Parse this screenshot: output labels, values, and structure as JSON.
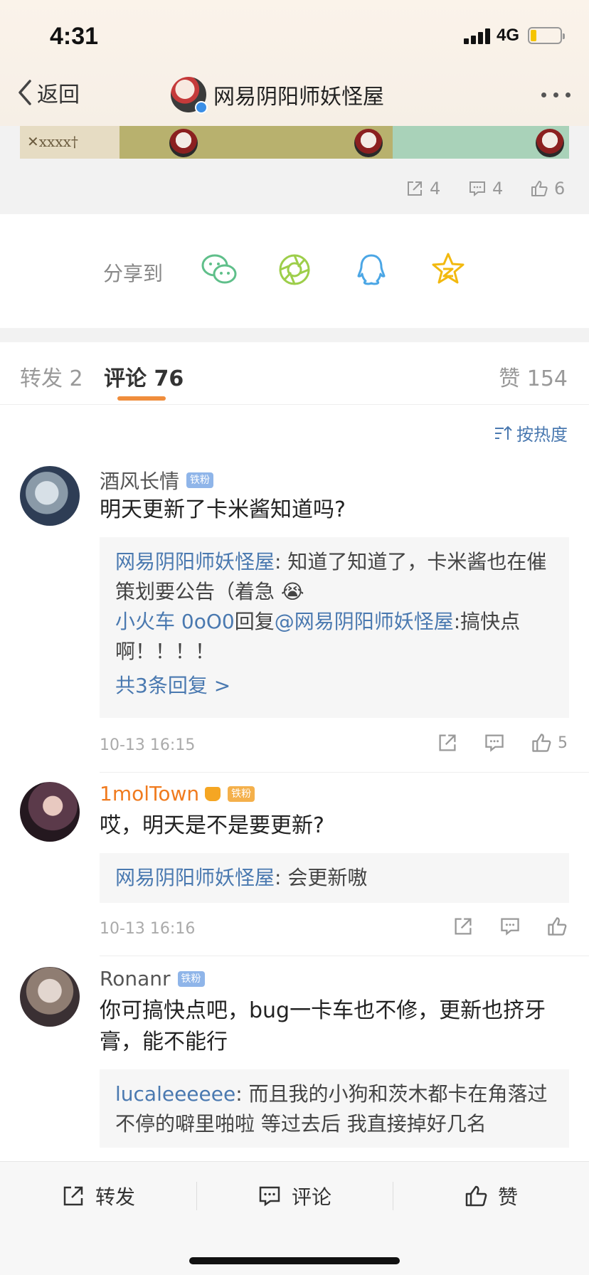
{
  "status": {
    "time": "4:31",
    "network": "4G"
  },
  "nav": {
    "back_label": "返回",
    "title": "网易阴阳师妖怪屋"
  },
  "post_stats": {
    "reposts": "4",
    "comments": "4",
    "likes": "6"
  },
  "share": {
    "label": "分享到",
    "icons": [
      "wechat-icon",
      "moments-icon",
      "qq-icon",
      "qzone-icon"
    ]
  },
  "tabs": {
    "repost": "转发 2",
    "comment": "评论 76",
    "like": "赞 154"
  },
  "sort": {
    "label": "按热度"
  },
  "comments": [
    {
      "name": "酒风长情",
      "badge": "铁粉",
      "text": "明天更新了卡米酱知道吗?",
      "replies": [
        {
          "who": "网易阴阳师妖怪屋",
          "text": ": 知道了知道了，卡米酱也在催策划要公告（着急 😭"
        },
        {
          "who": "小火车 0oO0",
          "mid": "回复",
          "at": "@网易阴阳师妖怪屋",
          "text": ":搞快点啊！！！！"
        }
      ],
      "more": "共3条回复 >",
      "time": "10-13 16:15",
      "likes": "5"
    },
    {
      "name": "1molTown",
      "badge": "铁粉",
      "text": "哎，明天是不是要更新?",
      "replies": [
        {
          "who": "网易阴阳师妖怪屋",
          "text": ": 会更新嗷"
        }
      ],
      "time": "10-13 16:16",
      "likes": ""
    },
    {
      "name": "Ronanr",
      "badge": "铁粉",
      "text": "你可搞快点吧，bug一卡车也不修，更新也挤牙膏，能不能行",
      "replies": [
        {
          "who": "lucaleeeeee",
          "text": ": 而且我的小狗和茨木都卡在角落过不停的噼里啪啦  等过去后 我直接掉好几名"
        }
      ]
    }
  ],
  "bottom_bar": {
    "repost": "转发",
    "comment": "评论",
    "like": "赞"
  },
  "colors": {
    "accent": "#f08d3c",
    "link": "#4a79b0",
    "gold": "#f5a623"
  }
}
